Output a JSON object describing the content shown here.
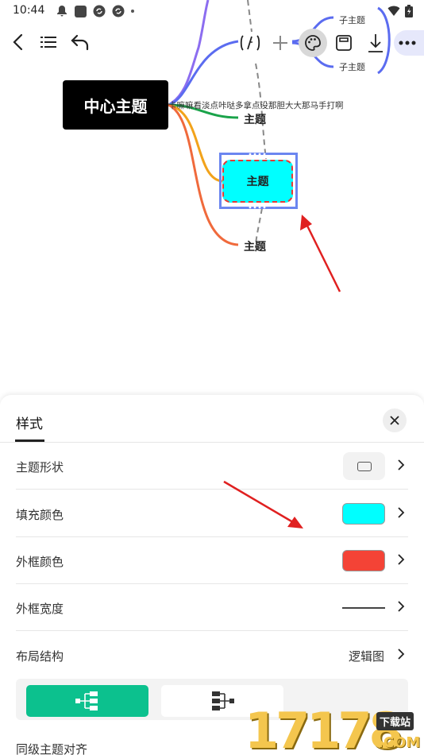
{
  "status_bar": {
    "time": "10:44"
  },
  "mindmap": {
    "center_topic": "中心主题",
    "long_text": "卡嘛嘛看淡点咔哒多拿点没那胆大大那马手打啊",
    "branches": [
      "主题",
      "主题",
      "主题"
    ],
    "selected_topic": "主题",
    "sub_topics": [
      "子主题",
      "子主题"
    ],
    "colors": {
      "branch_top": "#5b6cf0",
      "branch_green": "#1aa34a",
      "branch_orange": "#f2a31b",
      "branch_red": "#f06a3c",
      "selected_fill": "#00ffff",
      "selected_border": "#e53935",
      "arrow": "#e02020"
    }
  },
  "sheet": {
    "tab": "样式",
    "rows": [
      {
        "label": "主题形状"
      },
      {
        "label": "填充颜色",
        "color": "#00ffff"
      },
      {
        "label": "外框颜色",
        "color": "#f44336"
      },
      {
        "label": "外框宽度"
      },
      {
        "label": "布局结构",
        "value": "逻辑图"
      }
    ],
    "layout_options": [
      "logic-right-icon",
      "logic-left-icon"
    ],
    "align_label": "同级主题对齐",
    "colors": {
      "active_layout": "#0cc18e"
    }
  },
  "watermark": {
    "digits": "17178",
    "badge": "下载站",
    "suffix": ".COM"
  }
}
